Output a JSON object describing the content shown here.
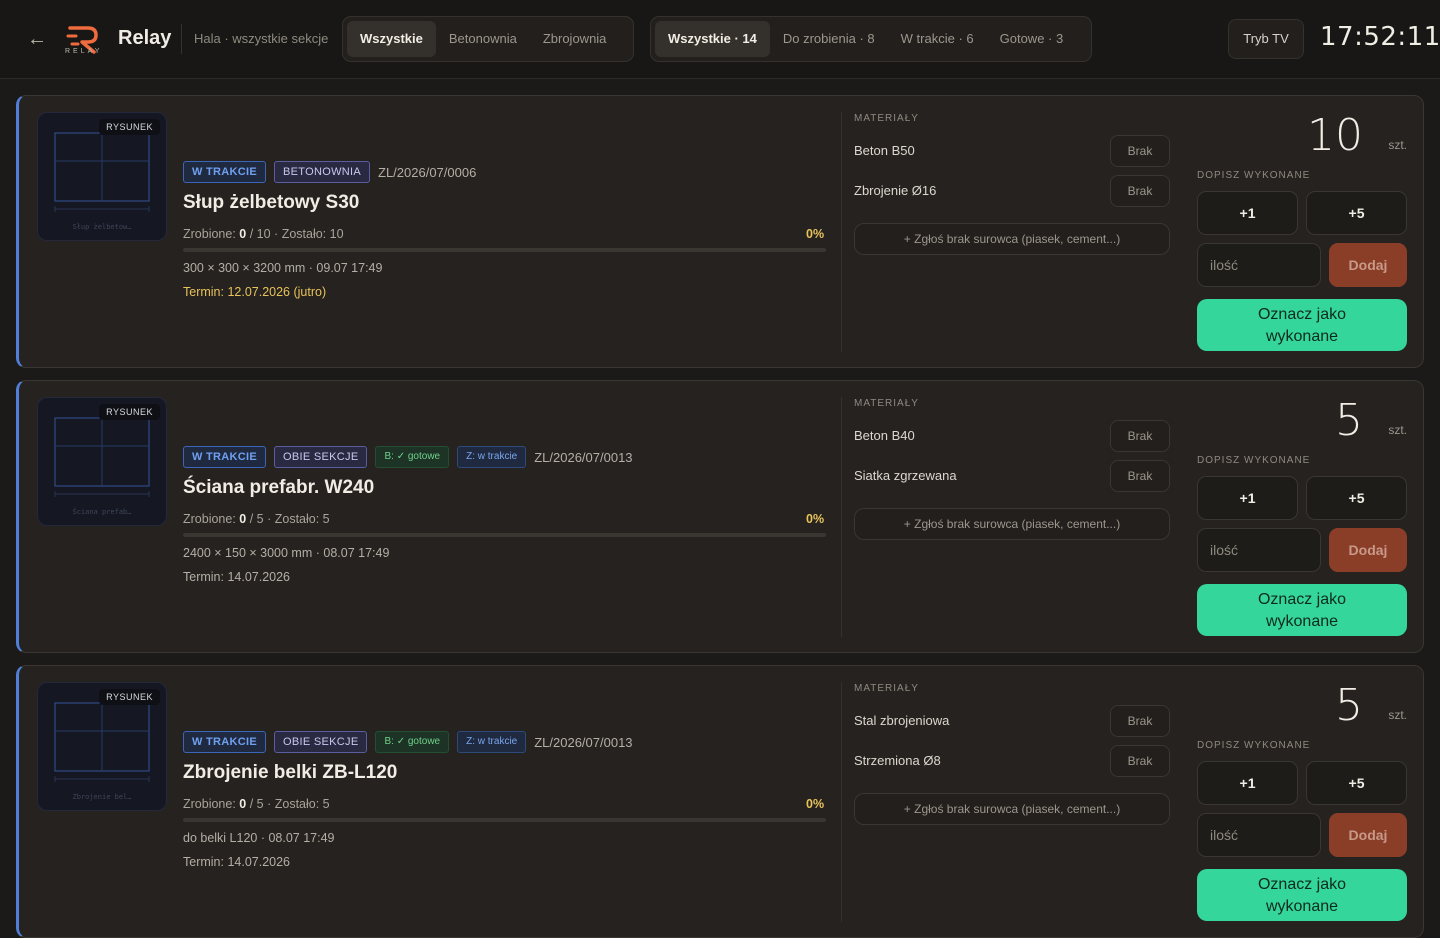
{
  "header": {
    "back_icon": "arrow-left-icon",
    "logo_sub": "RELAY",
    "app_name": "Relay",
    "subtitle": "Hala · wszystkie sekcje",
    "sections": [
      "Wszystkie",
      "Betonownia",
      "Zbrojownia"
    ],
    "statuses": [
      "Wszystkie · 14",
      "Do zrobienia · 8",
      "W trakcie · 6",
      "Gotowe · 3"
    ],
    "tv_label": "Tryb TV",
    "clock": "17:52:11",
    "accent": "#f06b3e"
  },
  "common": {
    "thumb_badge": "RYSUNEK",
    "materials_head": "MATERIAŁY",
    "material_action": "Brak",
    "report_label": "+ Zgłoś brak surowca (piasek, cement...)",
    "dopisz_head": "DOPISZ WYKONANE",
    "inc1": "+1",
    "inc5": "+5",
    "qty_placeholder": "ilość",
    "add_label": "Dodaj",
    "complete_line1": "Oznacz jako",
    "complete_line2": "wykonane",
    "unit": "szt."
  },
  "cards": [
    {
      "thumb_caption": "Słup żelbetow…",
      "status": "W TRAKCIE",
      "section": "BETONOWNIA",
      "order_no": "ZL/2026/07/0006",
      "title": "Słup żelbetowy S30",
      "done_label": "Zrobione:",
      "done": "0",
      "total_text": "/ 10 · Zostało: 10",
      "percent": "0%",
      "progress": 0,
      "spec": "300 × 300 × 3200 mm · 09.07 17:49",
      "deadline": "Termin: 12.07.2026 (jutro)",
      "materials": [
        "Beton B50",
        "Zbrojenie Ø16"
      ],
      "qty": "10"
    },
    {
      "thumb_caption": "Ściana prefab…",
      "status": "W TRAKCIE",
      "section": "OBIE SEKCJE",
      "tag_b": "B: ✓ gotowe",
      "tag_z": "Z: w trakcie",
      "order_no": "ZL/2026/07/0013",
      "title": "Ściana prefabr. W240",
      "done_label": "Zrobione:",
      "done": "0",
      "total_text": "/ 5 · Zostało: 5",
      "percent": "0%",
      "progress": 0,
      "spec": "2400 × 150 × 3000 mm · 08.07 17:49",
      "deadline": "Termin: 14.07.2026",
      "materials": [
        "Beton B40",
        "Siatka zgrzewana"
      ],
      "qty": "5"
    },
    {
      "thumb_caption": "Zbrojenie bel…",
      "status": "W TRAKCIE",
      "section": "OBIE SEKCJE",
      "tag_b": "B: ✓ gotowe",
      "tag_z": "Z: w trakcie",
      "order_no": "ZL/2026/07/0013",
      "title": "Zbrojenie belki ZB-L120",
      "done_label": "Zrobione:",
      "done": "0",
      "total_text": "/ 5 · Zostało: 5",
      "percent": "0%",
      "progress": 0,
      "spec": "do belki L120 · 08.07 17:49",
      "deadline": "Termin: 14.07.2026",
      "materials": [
        "Stal zbrojeniowa",
        "Strzemiona Ø8"
      ],
      "qty": "5"
    }
  ]
}
